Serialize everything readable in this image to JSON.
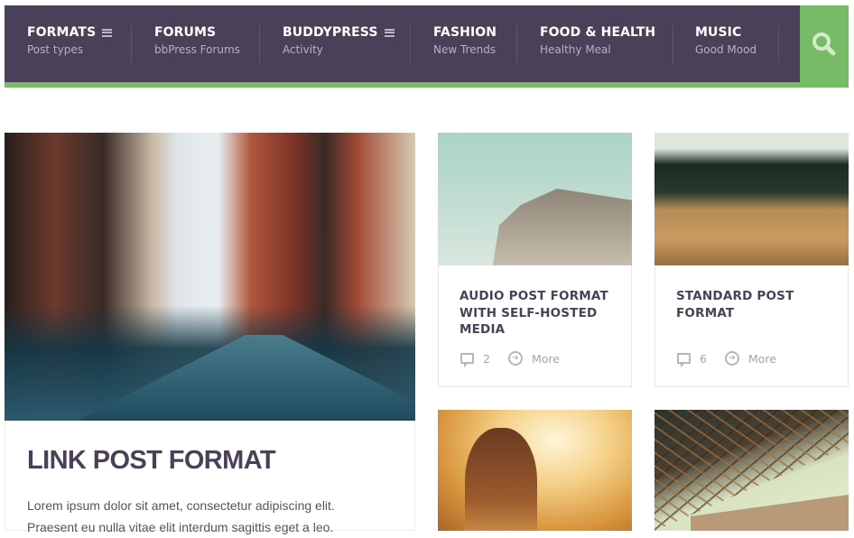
{
  "nav": {
    "items": [
      {
        "title": "FORMATS",
        "subtitle": "Post types",
        "has_menu_icon": true
      },
      {
        "title": "FORUMS",
        "subtitle": "bbPress Forums",
        "has_menu_icon": false
      },
      {
        "title": "BUDDYPRESS",
        "subtitle": "Activity",
        "has_menu_icon": true
      },
      {
        "title": "FASHION",
        "subtitle": "New Trends",
        "has_menu_icon": false
      },
      {
        "title": "FOOD & HEALTH",
        "subtitle": "Healthy Meal",
        "has_menu_icon": false
      },
      {
        "title": "MUSIC",
        "subtitle": "Good Mood",
        "has_menu_icon": false
      }
    ],
    "search_icon": "search-icon",
    "colors": {
      "bar": "#4a4158",
      "accent": "#77bb66"
    }
  },
  "posts": {
    "featured": {
      "title": "LINK POST FORMAT",
      "excerpt_line1": "Lorem ipsum dolor sit amet, consectetur adipiscing elit.",
      "excerpt_line2": "Praesent eu nulla vitae elit interdum sagittis eget a leo."
    },
    "cards": [
      {
        "title": "AUDIO POST FORMAT WITH SELF-HOSTED MEDIA",
        "comments": "2",
        "more_label": "More"
      },
      {
        "title": "STANDARD POST FORMAT",
        "comments": "6",
        "more_label": "More"
      }
    ]
  }
}
